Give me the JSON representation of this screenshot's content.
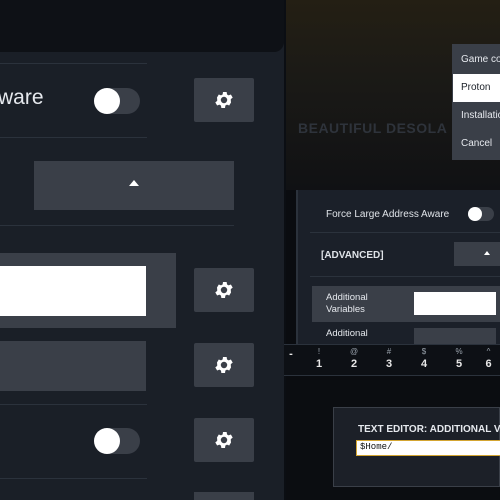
{
  "left": {
    "row1_label": "ware"
  },
  "menu": {
    "items": [
      "Game co",
      "Proton",
      "Installatio",
      "Cancel"
    ],
    "selected_index": 1
  },
  "right_panel": {
    "banner_text": "BEAUTIFUL DESOLA",
    "force_label": "Force Large Address Aware",
    "advanced_label": "[ADVANCED]",
    "additional_variables_label": "Additional Variables",
    "additional_label_2": "Additional"
  },
  "keyboard": {
    "keys": [
      {
        "sym": "",
        "num": "-"
      },
      {
        "sym": "!",
        "num": "1"
      },
      {
        "sym": "@",
        "num": "2"
      },
      {
        "sym": "#",
        "num": "3"
      },
      {
        "sym": "$",
        "num": "4"
      },
      {
        "sym": "%",
        "num": "5"
      },
      {
        "sym": "^",
        "num": "6"
      }
    ]
  },
  "editor": {
    "title": "TEXT EDITOR: ADDITIONAL V",
    "value": "$Home/"
  },
  "colors": {
    "panel_bg": "#1a1f27",
    "button_bg": "#3a3f48",
    "selected_menu_bg": "#ffffff",
    "menu_bg": "#3a3f48"
  }
}
